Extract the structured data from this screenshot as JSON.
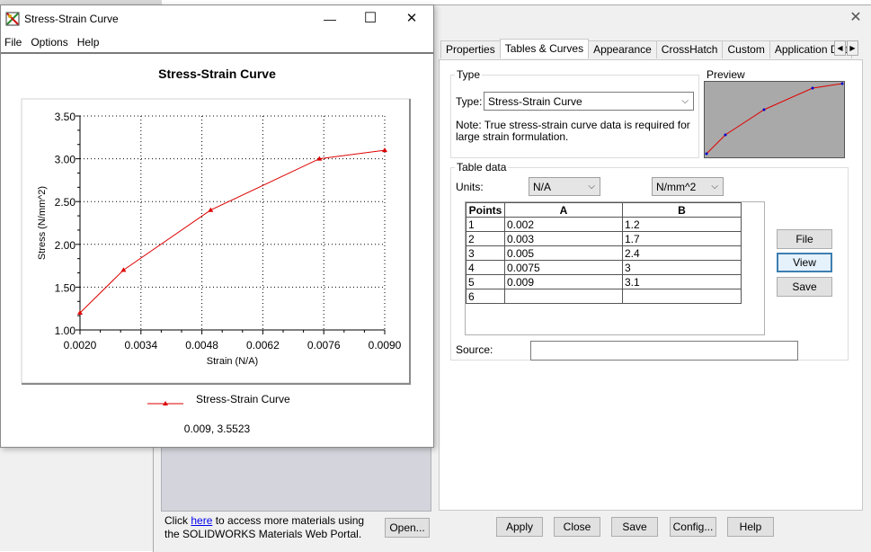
{
  "chart_window": {
    "title": "Stress-Strain Curve",
    "controls": {
      "minimize": "—",
      "maximize": "☐",
      "close": "✕"
    },
    "menu": [
      "File",
      "Options",
      "Help"
    ],
    "coordinate_readout": "0.009, 3.5523",
    "legend_label": "Stress-Strain Curve"
  },
  "chart_data": {
    "type": "line",
    "title": "Stress-Strain Curve",
    "xlabel": "Strain (N/A)",
    "ylabel": "Stress (N/mm^2)",
    "x_ticks": [
      "0.0020",
      "0.0034",
      "0.0048",
      "0.0062",
      "0.0076",
      "0.0090"
    ],
    "y_ticks": [
      "1.00",
      "1.50",
      "2.00",
      "2.50",
      "3.00",
      "3.50"
    ],
    "xlim": [
      0.002,
      0.009
    ],
    "ylim": [
      1.0,
      3.5
    ],
    "grid": true,
    "legend_position": "bottom",
    "series": [
      {
        "name": "Stress-Strain Curve",
        "color": "#dd0000",
        "marker": "triangle",
        "x": [
          0.002,
          0.003,
          0.005,
          0.0075,
          0.009
        ],
        "y": [
          1.2,
          1.7,
          2.4,
          3.0,
          3.1
        ]
      }
    ]
  },
  "material_dialog": {
    "close_glyph": "✕",
    "tabs": [
      "Properties",
      "Tables & Curves",
      "Appearance",
      "CrossHatch",
      "Custom",
      "Application Dat"
    ],
    "active_tab": "Tables & Curves",
    "tab_scroll": {
      "left": "◀",
      "right": "▶"
    },
    "type_group": {
      "legend": "Type",
      "type_label": "Type:",
      "type_value": "Stress-Strain Curve",
      "note": "Note: True stress-strain curve data is required for large strain formulation."
    },
    "preview": {
      "legend": "Preview"
    },
    "table_group": {
      "legend": "Table data",
      "units_label": "Units:",
      "units_a": "N/A",
      "units_b": "N/mm^2",
      "columns": [
        "Points",
        "A",
        "B"
      ],
      "rows": [
        [
          "1",
          "0.002",
          "1.2"
        ],
        [
          "2",
          "0.003",
          "1.7"
        ],
        [
          "3",
          "0.005",
          "2.4"
        ],
        [
          "4",
          "0.0075",
          "3"
        ],
        [
          "5",
          "0.009",
          "3.1"
        ],
        [
          "6",
          "",
          ""
        ]
      ],
      "file_button": "File",
      "view_button": "View",
      "save_button": "Save",
      "source_label": "Source:",
      "source_value": ""
    },
    "portal": {
      "text_before": "Click ",
      "link": "here",
      "text_after": " to access more materials using the SOLIDWORKS Materials Web Portal.",
      "open_button": "Open..."
    },
    "bottom_buttons": {
      "apply": "Apply",
      "close": "Close",
      "save": "Save",
      "config": "Config...",
      "help": "Help"
    }
  }
}
